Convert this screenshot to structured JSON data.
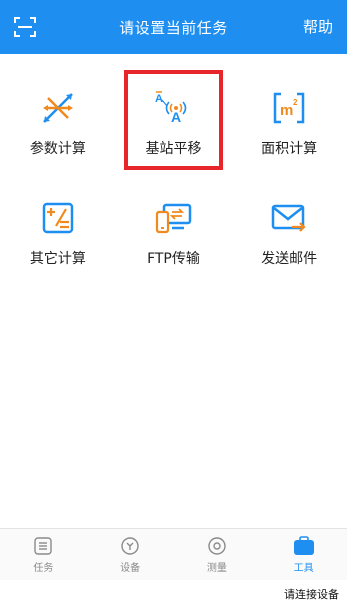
{
  "header": {
    "title": "请设置当前任务",
    "help_label": "帮助"
  },
  "tools": [
    {
      "label": "参数计算",
      "icon": "parameter-calc-icon"
    },
    {
      "label": "基站平移",
      "icon": "base-station-shift-icon",
      "highlighted": true
    },
    {
      "label": "面积计算",
      "icon": "area-calc-icon"
    },
    {
      "label": "其它计算",
      "icon": "other-calc-icon"
    },
    {
      "label": "FTP传输",
      "icon": "ftp-transfer-icon"
    },
    {
      "label": "发送邮件",
      "icon": "mail-icon"
    }
  ],
  "nav": {
    "items": [
      {
        "label": "任务",
        "icon": "task-list-icon"
      },
      {
        "label": "设备",
        "icon": "device-icon"
      },
      {
        "label": "测量",
        "icon": "measure-icon"
      },
      {
        "label": "工具",
        "icon": "toolbox-icon",
        "active": true
      }
    ]
  },
  "status": {
    "text": "请连接设备"
  },
  "colors": {
    "primary": "#1e8ff0",
    "accent_orange": "#f08a1e",
    "highlight_border": "#e8262a",
    "nav_inactive": "#8a8a8a"
  }
}
